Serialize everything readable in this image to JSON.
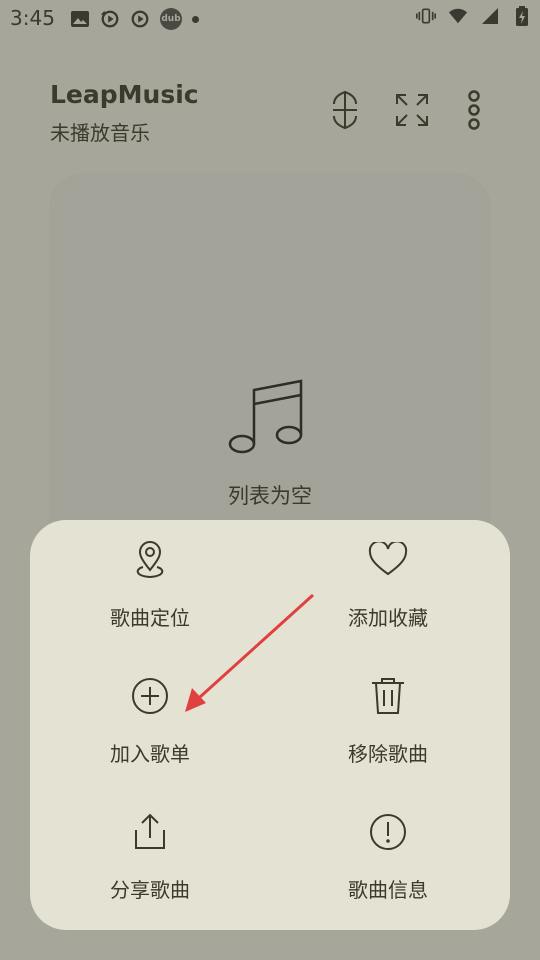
{
  "status_bar": {
    "time": "3:45",
    "left_icons": [
      "image-icon",
      "sync-icon",
      "play-circle-icon",
      "dub-icon",
      "dot-icon"
    ],
    "dub_label": "dub",
    "right_icons": [
      "vibrate-icon",
      "wifi-icon",
      "signal-icon",
      "battery-charging-icon"
    ]
  },
  "header": {
    "title": "LeapMusic",
    "subtitle": "未播放音乐"
  },
  "playlist": {
    "empty_text": "列表为空"
  },
  "sheet": {
    "actions": [
      {
        "label": "歌曲定位",
        "icon": "location-pin-icon"
      },
      {
        "label": "添加收藏",
        "icon": "heart-icon"
      },
      {
        "label": "加入歌单",
        "icon": "add-circle-icon"
      },
      {
        "label": "移除歌曲",
        "icon": "trash-icon"
      },
      {
        "label": "分享歌曲",
        "icon": "share-icon"
      },
      {
        "label": "歌曲信息",
        "icon": "info-icon"
      }
    ]
  },
  "colors": {
    "background": "#a7a69b",
    "sheet": "#e4e3d3",
    "text": "#3c3a2c",
    "annotation_arrow": "#e04040"
  }
}
